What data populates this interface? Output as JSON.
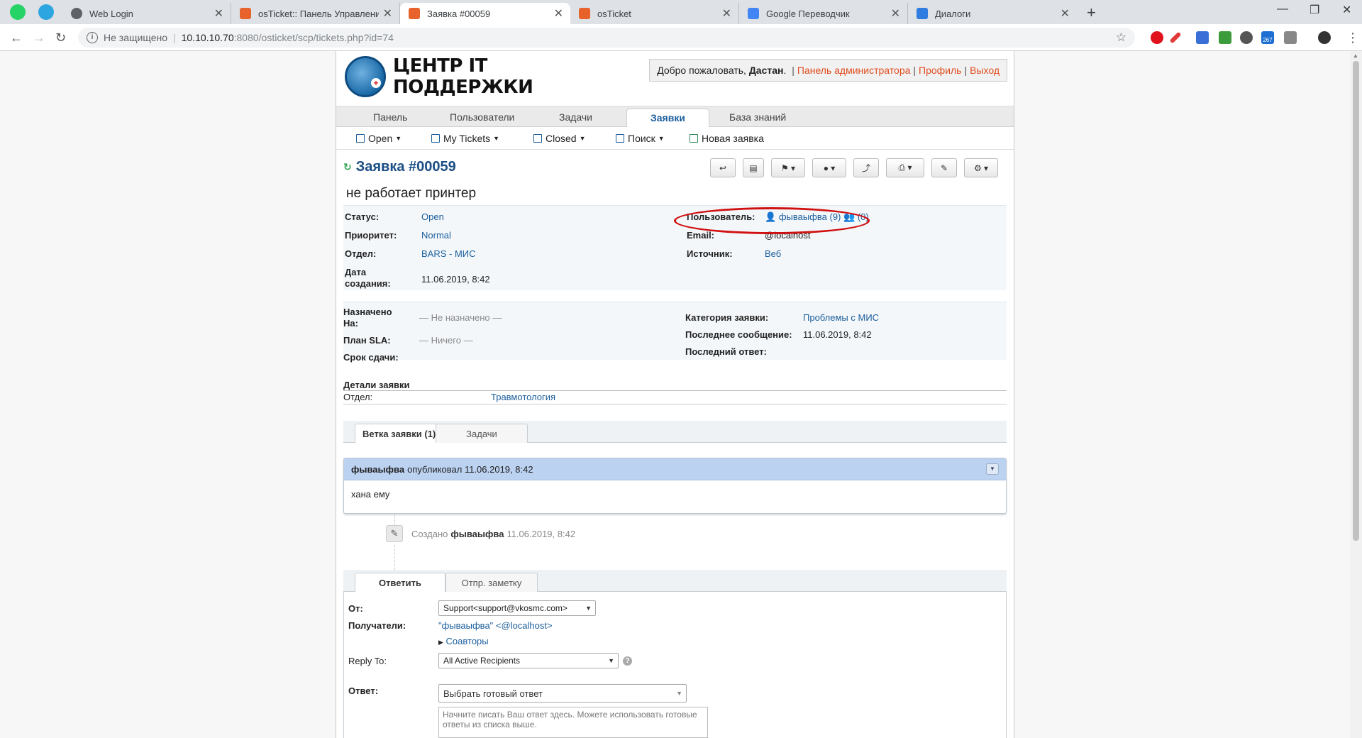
{
  "browser": {
    "tabs": [
      {
        "title": "Web Login",
        "favicon_color": "#5f6368"
      },
      {
        "title": "osTicket:: Панель Управления А",
        "favicon_color": "#e8622c"
      },
      {
        "title": "Заявка #00059",
        "favicon_color": "#e8622c"
      },
      {
        "title": "osTicket",
        "favicon_color": "#e8622c"
      },
      {
        "title": "Google Переводчик",
        "favicon_color": "#4285f4"
      },
      {
        "title": "Диалоги",
        "favicon_color": "#2f7de1"
      }
    ],
    "address": {
      "insecure": "Не защищено",
      "host": "10.10.10.70",
      "path": ":8080/osticket/scp/tickets.php?id=74"
    },
    "extension_badge": "267"
  },
  "header": {
    "logo_line1": "ЦЕНТР IT",
    "logo_line2": "ПОДДЕРЖКИ",
    "welcome_prefix": "Добро пожаловать, ",
    "welcome_user": "Дастан",
    "welcome_dot": ".",
    "admin_panel": "Панель администратора",
    "profile": "Профиль",
    "logout": "Выход"
  },
  "nav": {
    "tabs": [
      "Панель",
      "Пользователи",
      "Задачи",
      "Заявки",
      "База знаний"
    ],
    "active": "Заявки"
  },
  "subnav": {
    "open": "Open",
    "my_tickets": "My Tickets",
    "closed": "Closed",
    "search": "Поиск",
    "new_ticket": "Новая заявка"
  },
  "ticket": {
    "title": "Заявка #00059",
    "subject": "не работает принтер",
    "status_label": "Статус:",
    "status": "Open",
    "priority_label": "Приоритет:",
    "priority": "Normal",
    "department_label": "Отдел:",
    "department": "BARS - МИС",
    "created_label_1": "Дата",
    "created_label_2": "создания:",
    "created": "11.06.2019, 8:42",
    "user_label": "Пользователь:",
    "user": "фываыфва",
    "user_tickets": "(9)",
    "user_org": "(0)",
    "email_label": "Email:",
    "email": "@localhost",
    "source_label": "Источник:",
    "source": "Веб",
    "assigned_label_1": "Назначено",
    "assigned_label_2": "На:",
    "assigned": "— Не назначено —",
    "sla_label": "План SLA:",
    "sla": "— Ничего —",
    "due_label": "Срок сдачи:",
    "category_label": "Категория заявки:",
    "category": "Проблемы с МИС",
    "last_message_label": "Последнее сообщение:",
    "last_message": "11.06.2019, 8:42",
    "last_reply_label": "Последний ответ:",
    "details_heading": "Детали заявки",
    "details_dept_label": "Отдел:",
    "details_dept": "Травмотология"
  },
  "thread": {
    "tab_thread": "Ветка заявки (1)",
    "tab_tasks": "Задачи",
    "author": "фываыфва",
    "posted_text": "опубликовал 11.06.2019, 8:42",
    "body": "хана ему",
    "event_prefix": "Создано",
    "event_author": "фываыфва",
    "event_time": "11.06.2019, 8:42"
  },
  "reply": {
    "tab_reply": "Ответить",
    "tab_note": "Отпр. заметку",
    "from_label": "От:",
    "from_value": "Support<support@vkosmc.com>",
    "recipients_label": "Получатели:",
    "recipients_value": "\"фываыфва\" <@localhost>",
    "collaborators": "Соавторы",
    "reply_to_label": "Reply To:",
    "reply_to_value": "All Active Recipients",
    "response_label": "Ответ:",
    "canned_placeholder": "Выбрать готовый ответ",
    "textarea_placeholder": "Начните писать Ваш ответ здесь. Можете использовать готовые ответы из списка выше."
  }
}
